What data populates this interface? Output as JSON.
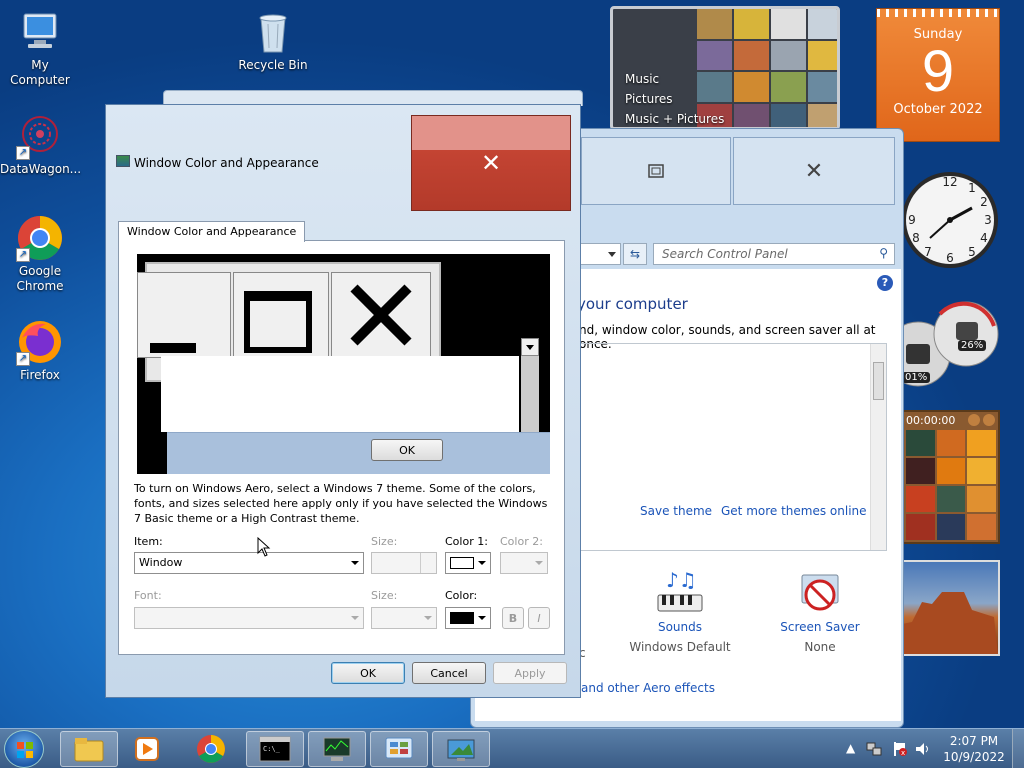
{
  "desktop": {
    "icons": [
      {
        "label": "My Computer",
        "icon": "computer-icon"
      },
      {
        "label": "Recycle Bin",
        "icon": "recycle-bin-icon"
      },
      {
        "label": "DataWagon...",
        "icon": "datawagon-icon"
      },
      {
        "label": "Google Chrome",
        "icon": "chrome-icon"
      },
      {
        "label": "Firefox",
        "icon": "firefox-icon"
      }
    ]
  },
  "gadgets": {
    "media": {
      "items": [
        "Music",
        "Pictures",
        "Music + Pictures"
      ]
    },
    "calendar": {
      "weekday": "Sunday",
      "day": "9",
      "month_year": "October 2022"
    },
    "cpu": {
      "cpu_percent": "01%",
      "mem_percent": "26%"
    },
    "puzzle": {
      "timer": "00:00:00"
    }
  },
  "control_panel": {
    "search_placeholder": "Search Control Panel",
    "heading": "your computer",
    "subtext": "nd, window color, sounds, and screen saver all at once.",
    "save_theme": "Save theme",
    "get_more": "Get more themes online",
    "sounds_label": "Sounds",
    "sounds_value": "Windows Default",
    "saver_label": "Screen Saver",
    "saver_value": "None",
    "aero_link": "and other Aero effects",
    "left_fragment": "c"
  },
  "dialog": {
    "title": "Window Color and Appearance",
    "tab": "Window Color and Appearance",
    "preview_ok": "OK",
    "description": "To turn on Windows Aero, select a Windows 7 theme.  Some of the colors, fonts, and sizes selected here apply only if you have selected the Windows 7 Basic theme or a High Contrast theme.",
    "item_label": "Item:",
    "item_value": "Window",
    "size_label": "Size:",
    "color1_label": "Color 1:",
    "color2_label": "Color 2:",
    "font_label": "Font:",
    "font_size_label": "Size:",
    "color_label": "Color:",
    "bold_label": "B",
    "italic_label": "I",
    "ok": "OK",
    "cancel": "Cancel",
    "apply": "Apply",
    "color1": "#ffffff",
    "color": "#000000"
  },
  "taskbar": {
    "time": "2:07 PM",
    "date": "10/9/2022"
  }
}
